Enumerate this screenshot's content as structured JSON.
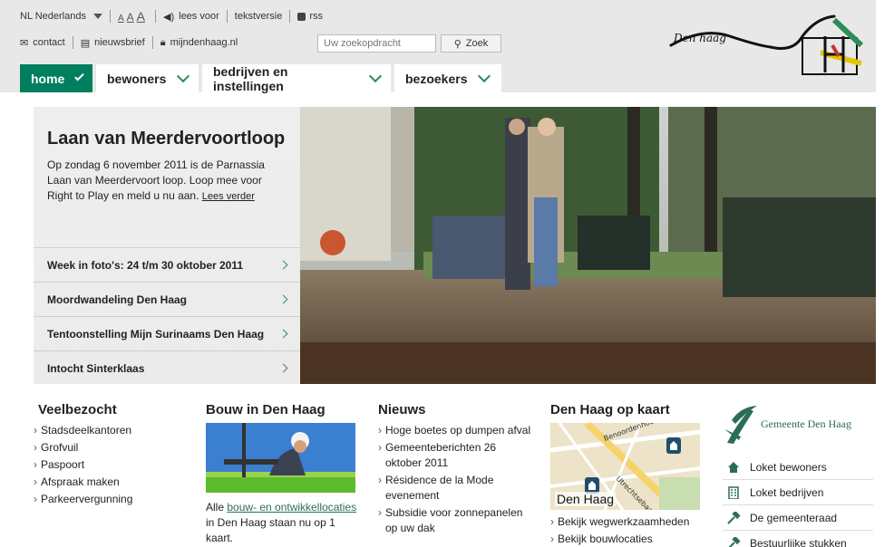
{
  "utility": {
    "language": "NL Nederlands",
    "font_sizes": [
      "A",
      "A",
      "A"
    ],
    "read_aloud": "lees voor",
    "text_version": "tekstversie",
    "rss": "rss",
    "contact": "contact",
    "newsletter": "nieuwsbrief",
    "mydenhaag": "mijndenhaag.nl"
  },
  "search": {
    "placeholder": "Uw zoekopdracht",
    "button": "Zoek"
  },
  "logo_text": "Den haag",
  "nav": [
    {
      "label": "home",
      "active": true
    },
    {
      "label": "bewoners",
      "active": false
    },
    {
      "label": "bedrijven en instellingen",
      "active": false
    },
    {
      "label": "bezoekers",
      "active": false
    }
  ],
  "hero": {
    "title": "Laan van Meerdervoortloop",
    "text": "Op zondag 6 november 2011 is de Parnassia Laan van Meerdervoort loop. Loop mee voor Right to Play en meld u nu aan.",
    "more": "Lees verder",
    "links": [
      "Week in foto's: 24 t/m 30 oktober 2011",
      "Moordwandeling Den Haag",
      "Tentoonstelling Mijn Surinaams Den Haag",
      "Intocht Sinterklaas"
    ]
  },
  "veelbezocht": {
    "title": "Veelbezocht",
    "items": [
      "Stadsdeelkantoren",
      "Grofvuil",
      "Paspoort",
      "Afspraak maken",
      "Parkeervergunning"
    ]
  },
  "bouw": {
    "title": "Bouw in Den Haag",
    "text_before": "Alle ",
    "link": "bouw- en ontwikkellocaties",
    "text_after": " in Den Haag staan nu op 1 kaart."
  },
  "nieuws": {
    "title": "Nieuws",
    "items": [
      "Hoge boetes op dumpen afval",
      "Gemeenteberichten 26 oktober 2011",
      "Résidence de la Mode evenement",
      "Subsidie voor zonnepanelen op uw dak"
    ]
  },
  "kaart": {
    "title": "Den Haag op kaart",
    "map_label": "Den Haag",
    "street1": "Benoordenhout",
    "street2": "Utrechtsebaan",
    "items": [
      "Bekijk wegwerkzaamheden",
      "Bekijk bouwlocaties"
    ]
  },
  "gemeente": {
    "name": "Gemeente Den Haag",
    "links": [
      {
        "label": "Loket bewoners",
        "icon": "house-icon"
      },
      {
        "label": "Loket bedrijven",
        "icon": "building-icon"
      },
      {
        "label": "De gemeenteraad",
        "icon": "gavel-icon"
      },
      {
        "label": "Bestuurlijke stukken",
        "icon": "gavel-icon"
      }
    ]
  },
  "colors": {
    "accent": "#007f5f",
    "link_green": "#2a6e55",
    "topbar": "#e8e8e8"
  }
}
